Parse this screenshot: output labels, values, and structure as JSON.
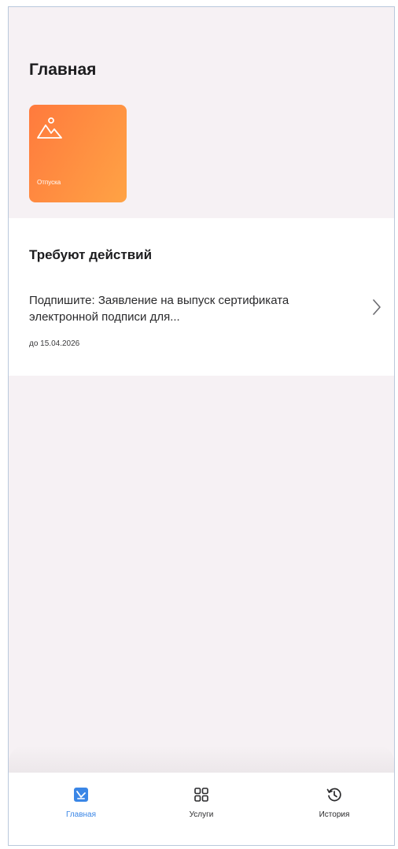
{
  "page": {
    "title": "Главная"
  },
  "tiles": [
    {
      "label": "Отпуска",
      "icon": "mountain-sun-icon"
    }
  ],
  "actions": {
    "title": "Требуют действий",
    "items": [
      {
        "text": "Подпишите: Заявление на выпуск сертификата электронной подписи для...",
        "deadline": "до 15.04.2026",
        "icon": "chevron-right-icon"
      }
    ]
  },
  "tabbar": {
    "tabs": [
      {
        "label": "Главная",
        "icon": "home-app-icon",
        "active": true
      },
      {
        "label": "Услуги",
        "icon": "grid-icon",
        "active": false
      },
      {
        "label": "История",
        "icon": "history-icon",
        "active": false
      }
    ]
  },
  "colors": {
    "accent": "#3a86e6",
    "tile_start": "#ff7a3d",
    "tile_end": "#ffa345",
    "background": "#f6f1f4"
  }
}
